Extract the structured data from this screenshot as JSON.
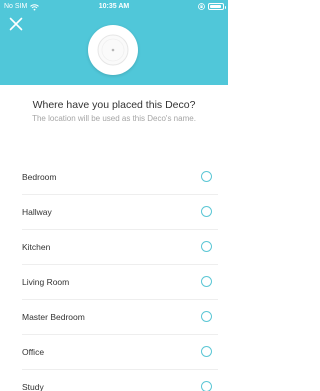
{
  "status_bar": {
    "carrier": "No SIM",
    "time": "10:35 AM",
    "icons": [
      "wifi-icon",
      "lock-rotation-icon",
      "battery-icon"
    ],
    "battery_level": 0.9
  },
  "header": {
    "background_color": "#50c7d9",
    "close_icon": "close-icon",
    "device_image": "deco-device-icon"
  },
  "main": {
    "title": "Where have you placed this Deco?",
    "subtitle": "The location will be used as this Deco's name."
  },
  "locations": [
    {
      "label": "Bedroom",
      "selected": false
    },
    {
      "label": "Hallway",
      "selected": false
    },
    {
      "label": "Kitchen",
      "selected": false
    },
    {
      "label": "Living Room",
      "selected": false
    },
    {
      "label": "Master Bedroom",
      "selected": false
    },
    {
      "label": "Office",
      "selected": false
    },
    {
      "label": "Study",
      "selected": false
    }
  ],
  "colors": {
    "accent": "#50c7d9",
    "radio_border": "#5cc7d5",
    "title_text": "#333333",
    "subtitle_text": "#a5a5a5"
  }
}
